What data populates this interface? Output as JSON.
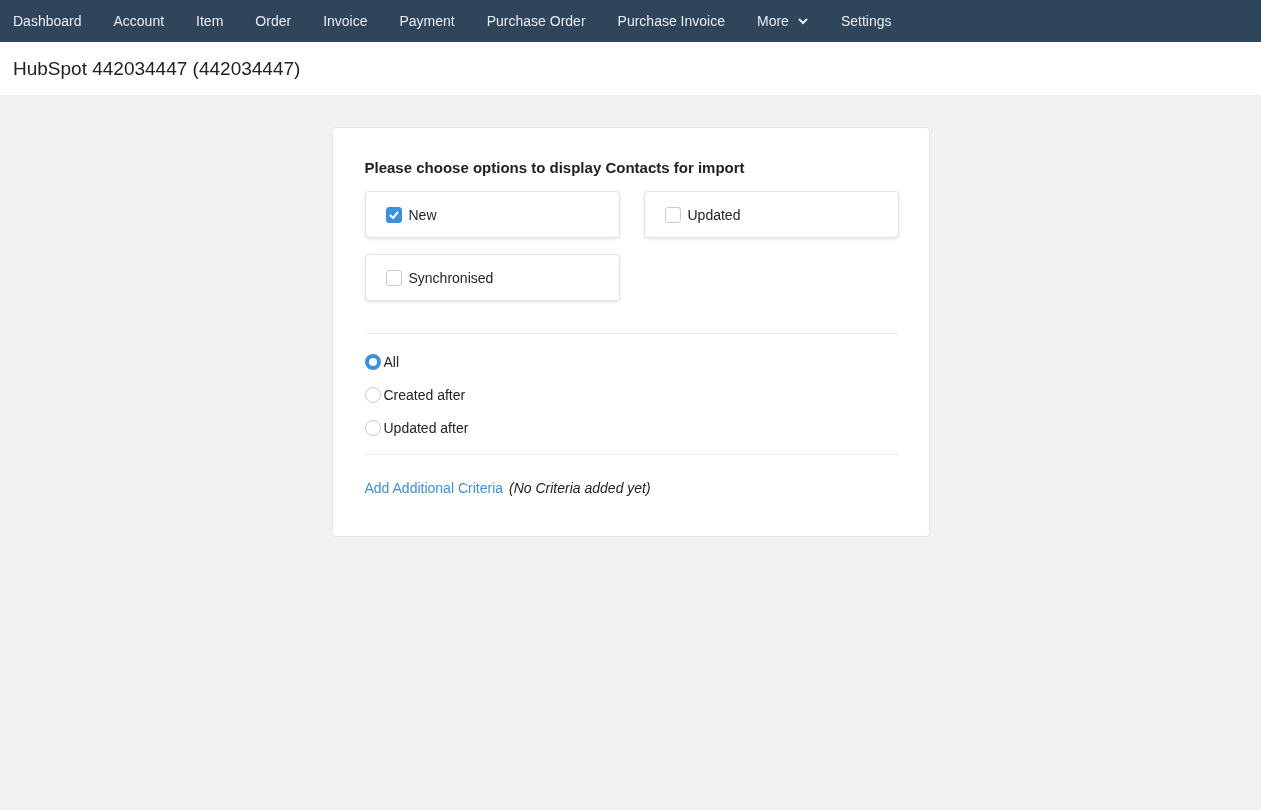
{
  "nav": {
    "items": [
      {
        "label": "Dashboard",
        "kind": "link"
      },
      {
        "label": "Account",
        "kind": "link"
      },
      {
        "label": "Item",
        "kind": "link"
      },
      {
        "label": "Order",
        "kind": "link"
      },
      {
        "label": "Invoice",
        "kind": "link"
      },
      {
        "label": "Payment",
        "kind": "link"
      },
      {
        "label": "Purchase Order",
        "kind": "link"
      },
      {
        "label": "Purchase Invoice",
        "kind": "link"
      },
      {
        "label": "More",
        "kind": "dropdown"
      },
      {
        "label": "Settings",
        "kind": "link"
      }
    ]
  },
  "page_title": "HubSpot 442034447 (442034447)",
  "card": {
    "heading": "Please choose options to display Contacts for import",
    "filters": [
      {
        "label": "New",
        "checked": true
      },
      {
        "label": "Updated",
        "checked": false
      },
      {
        "label": "Synchronised",
        "checked": false
      }
    ],
    "date_options": [
      {
        "label": "All",
        "selected": true
      },
      {
        "label": "Created after",
        "selected": false
      },
      {
        "label": "Updated after",
        "selected": false
      }
    ],
    "criteria_link": "Add Additional Criteria",
    "criteria_note": "(No Criteria added yet)"
  }
}
